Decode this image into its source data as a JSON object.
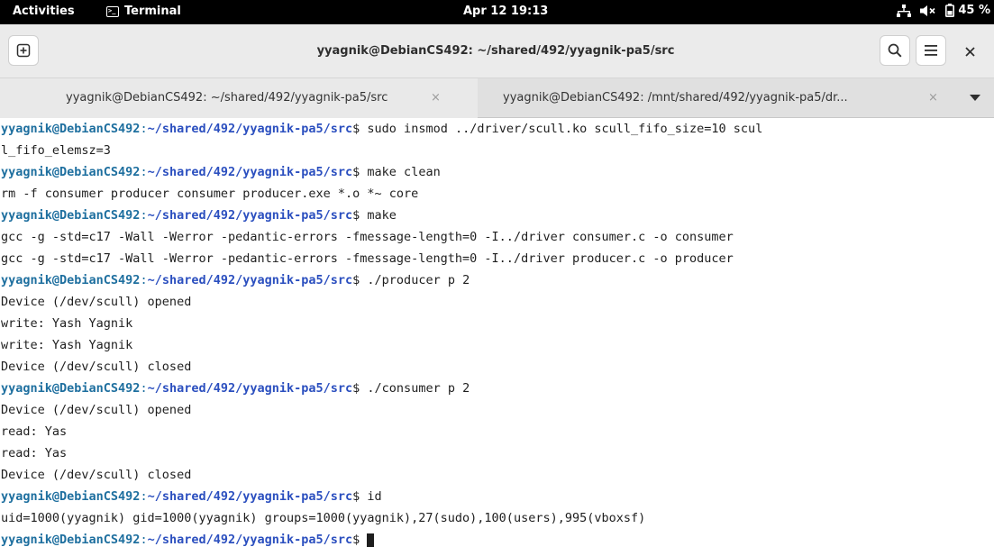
{
  "topbar": {
    "activities": "Activities",
    "app_name": "Terminal",
    "app_icon": "terminal-icon",
    "clock": "Apr 12 19:13",
    "battery": "45 %",
    "status_icons": [
      "network-icon",
      "volume-muted-icon",
      "battery-icon"
    ]
  },
  "window": {
    "title": "yyagnik@DebianCS492: ~/shared/492/yyagnik-pa5/src",
    "buttons": [
      "new-tab-icon",
      "search-icon",
      "hamburger-menu-icon",
      "close-icon"
    ],
    "close_label": "×"
  },
  "tabs": [
    {
      "label": "yyagnik@DebianCS492: ~/shared/492/yyagnik-pa5/src",
      "close": "×",
      "active": true
    },
    {
      "label": "yyagnik@DebianCS492: /mnt/shared/492/yyagnik-pa5/dr...",
      "close": "×",
      "active": false
    }
  ],
  "prompt": {
    "user_host": "yyagnik@DebianCS492",
    "colon": ":",
    "path": "~/shared/492/yyagnik-pa5/src",
    "dollar": "$ "
  },
  "terminal": {
    "lines": [
      {
        "prompt": true,
        "cmd": "sudo insmod ../driver/scull.ko scull_fifo_size=10 scul"
      },
      {
        "prompt": false,
        "text": "l_fifo_elemsz=3"
      },
      {
        "prompt": true,
        "cmd": "make clean"
      },
      {
        "prompt": false,
        "text": "rm -f consumer producer consumer producer.exe *.o *~ core"
      },
      {
        "prompt": true,
        "cmd": "make"
      },
      {
        "prompt": false,
        "text": "gcc -g -std=c17 -Wall -Werror -pedantic-errors -fmessage-length=0 -I../driver consumer.c -o consumer"
      },
      {
        "prompt": false,
        "text": "gcc -g -std=c17 -Wall -Werror -pedantic-errors -fmessage-length=0 -I../driver producer.c -o producer"
      },
      {
        "prompt": true,
        "cmd": "./producer p 2"
      },
      {
        "prompt": false,
        "text": "Device (/dev/scull) opened"
      },
      {
        "prompt": false,
        "text": "write: Yash Yagnik"
      },
      {
        "prompt": false,
        "text": "write: Yash Yagnik"
      },
      {
        "prompt": false,
        "text": "Device (/dev/scull) closed"
      },
      {
        "prompt": true,
        "cmd": "./consumer p 2"
      },
      {
        "prompt": false,
        "text": "Device (/dev/scull) opened"
      },
      {
        "prompt": false,
        "text": "read: Yas"
      },
      {
        "prompt": false,
        "text": "read: Yas"
      },
      {
        "prompt": false,
        "text": "Device (/dev/scull) closed"
      },
      {
        "prompt": true,
        "cmd": "id"
      },
      {
        "prompt": false,
        "text": "uid=1000(yyagnik) gid=1000(yyagnik) groups=1000(yyagnik),27(sudo),100(users),995(vboxsf)"
      },
      {
        "prompt": true,
        "cmd": "",
        "cursor": true
      }
    ]
  },
  "colors": {
    "prompt_user": "#1e6f9f",
    "prompt_path": "#2b4fbf",
    "text": "#1e1e1e",
    "topbar_bg": "#000000"
  }
}
